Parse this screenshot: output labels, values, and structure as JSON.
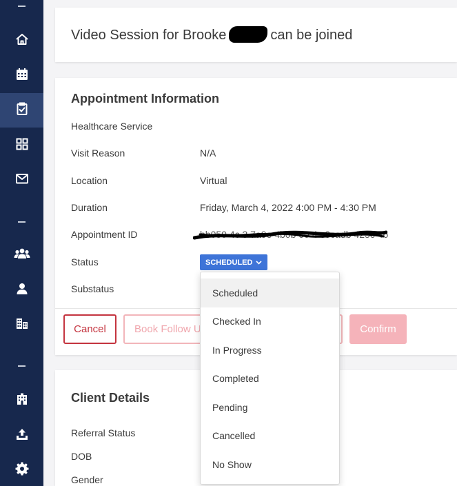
{
  "sidebar": {
    "items": [
      {
        "icon": "home-icon",
        "name": "home"
      },
      {
        "icon": "calendar-icon",
        "name": "calendar"
      },
      {
        "icon": "clipboard-check-icon",
        "name": "appointments",
        "active": true
      },
      {
        "icon": "grid-icon",
        "name": "dashboard"
      },
      {
        "icon": "mail-icon",
        "name": "messages"
      },
      {
        "icon": "users-icon",
        "name": "clients"
      },
      {
        "icon": "user-icon",
        "name": "providers"
      },
      {
        "icon": "buildings-icon",
        "name": "organizations"
      },
      {
        "icon": "building-icon",
        "name": "facilities"
      },
      {
        "icon": "upload-icon",
        "name": "upload"
      },
      {
        "icon": "gear-icon",
        "name": "settings"
      }
    ]
  },
  "banner": {
    "text_before": "Video Session for Brooke",
    "text_after": "can be joined"
  },
  "appointment": {
    "title": "Appointment Information",
    "fields": {
      "healthcare_service": {
        "label": "Healthcare Service",
        "value": ""
      },
      "visit_reason": {
        "label": "Visit Reason",
        "value": "N/A"
      },
      "location": {
        "label": "Location",
        "value": "Virtual"
      },
      "duration": {
        "label": "Duration",
        "value": "Friday, March 4, 2022 4:00 PM - 4:30 PM"
      },
      "appointment_id": {
        "label": "Appointment ID",
        "value": "bb050 4c 3 7a9e 4b0b 00 4 c9cadb 425c 46"
      },
      "status": {
        "label": "Status",
        "value": "SCHEDULED"
      },
      "substatus": {
        "label": "Substatus",
        "value": ""
      }
    },
    "buttons": {
      "cancel": "Cancel",
      "book_follow_up": "Book Follow Up",
      "confirm": "Confirm"
    }
  },
  "client": {
    "title": "Client Details",
    "fields": {
      "referral_status": {
        "label": "Referral Status"
      },
      "dob": {
        "label": "DOB"
      },
      "gender": {
        "label": "Gender"
      }
    }
  },
  "status_dropdown": {
    "selected": "Scheduled",
    "options": [
      "Scheduled",
      "Checked In",
      "In Progress",
      "Completed",
      "Pending",
      "Cancelled",
      "No Show"
    ]
  },
  "colors": {
    "sidebar_bg": "#17284d",
    "sidebar_active": "#2f4573",
    "status_chip": "#3e74d8",
    "danger": "#c4343f",
    "confirm_disabled": "#f5b3ba"
  }
}
